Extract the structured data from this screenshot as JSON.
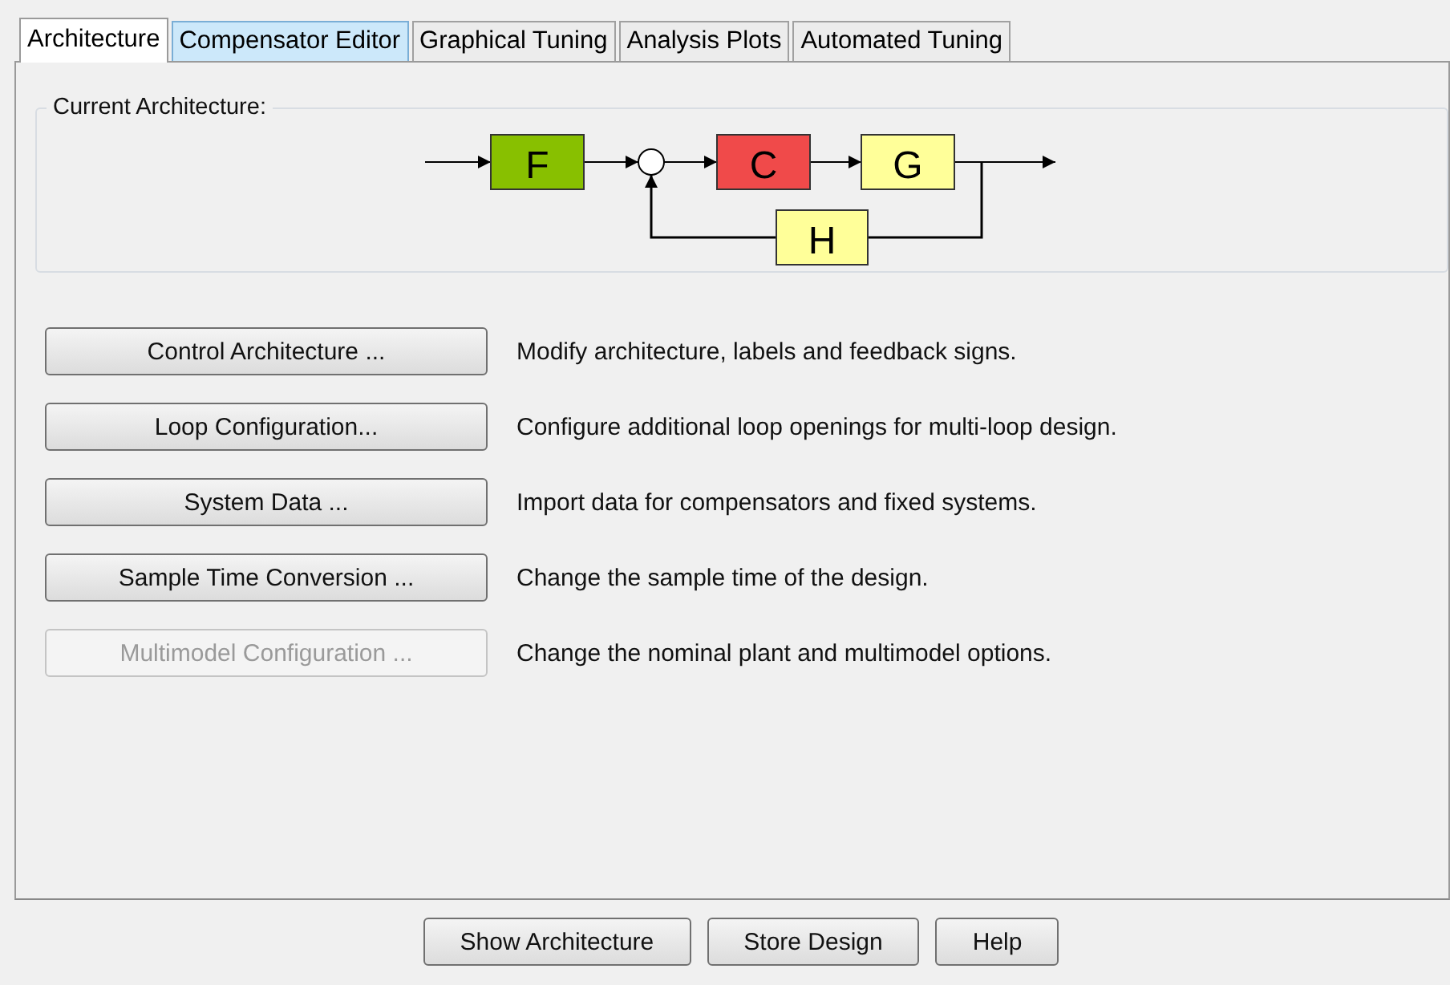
{
  "tabs": [
    {
      "label": "Architecture",
      "selected": true,
      "highlighted": false
    },
    {
      "label": "Compensator Editor",
      "selected": false,
      "highlighted": true
    },
    {
      "label": "Graphical Tuning",
      "selected": false,
      "highlighted": false
    },
    {
      "label": "Analysis Plots",
      "selected": false,
      "highlighted": false
    },
    {
      "label": "Automated Tuning",
      "selected": false,
      "highlighted": false
    }
  ],
  "current_architecture": {
    "label": "Current Architecture:",
    "blocks": [
      {
        "label": "F",
        "color": "#88c000"
      },
      {
        "label": "C",
        "color": "#f04a4a"
      },
      {
        "label": "G",
        "color": "#ffff99"
      },
      {
        "label": "H",
        "color": "#ffff99"
      }
    ]
  },
  "actions": [
    {
      "button": "Control Architecture ...",
      "description": "Modify architecture, labels and feedback signs.",
      "disabled": false
    },
    {
      "button": "Loop Configuration...",
      "description": "Configure additional loop openings for multi-loop design.",
      "disabled": false
    },
    {
      "button": "System Data ...",
      "description": "Import data for compensators and fixed systems.",
      "disabled": false
    },
    {
      "button": "Sample Time Conversion ...",
      "description": "Change the sample time of the design.",
      "disabled": false
    },
    {
      "button": "Multimodel Configuration ...",
      "description": "Change the nominal plant and multimodel options.",
      "disabled": true
    }
  ],
  "footer_buttons": [
    "Show Architecture",
    "Store Design",
    "Help"
  ]
}
